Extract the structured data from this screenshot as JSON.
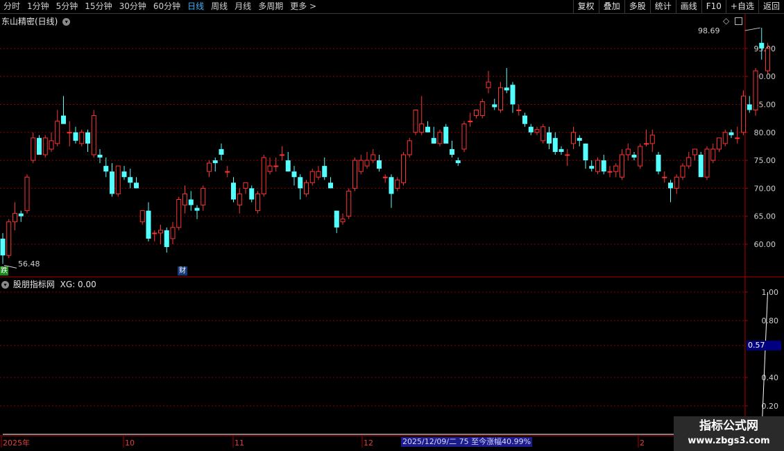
{
  "toolbar": {
    "periods": [
      "分时",
      "1分钟",
      "5分钟",
      "15分钟",
      "30分钟",
      "60分钟",
      "日线",
      "周线",
      "月线",
      "多周期",
      "更多 >"
    ],
    "active_period": "日线",
    "buttons": [
      "复权",
      "叠加",
      "多股",
      "统计",
      "画线",
      "F10",
      "+自选",
      "返回"
    ]
  },
  "main_panel": {
    "title": "东山精密(日线)",
    "high_label": "98.69",
    "low_label": "56.48",
    "left_marker": "跌",
    "finance_marker": "财",
    "corner_icons": [
      "diamond-icon",
      "window-icon"
    ]
  },
  "indicator_panel": {
    "title": "股朋指标网",
    "formula": "XG: 0.00",
    "current_value_label": "0.57"
  },
  "date_axis": {
    "labels": [
      "2025年",
      "10",
      "11",
      "12",
      "2"
    ],
    "status": "2025/12/09/二 75 至今涨幅40.99%"
  },
  "watermark": {
    "title": "指标公式网",
    "url": "www.zbgs3.com"
  },
  "colors": {
    "up": "#ff3232",
    "down": "#54ffff",
    "grid": "#8b0000",
    "axis": "#b00000",
    "active": "#3fb3ff",
    "xg_line": "#ffffff"
  },
  "chart_data": [
    {
      "type": "candlestick",
      "title": "东山精密(日线)",
      "ylim": [
        55,
        100
      ],
      "yticks": [
        "60.00",
        "65.00",
        "70.00",
        "75.00",
        "80.00",
        "85.00",
        "90.00",
        "95.00"
      ],
      "ohlc": [
        [
          61,
          62,
          56.48,
          58
        ],
        [
          58,
          64.5,
          57.5,
          64
        ],
        [
          64,
          67.5,
          62.5,
          65.5
        ],
        [
          65.5,
          66,
          64,
          65
        ],
        [
          66,
          72.5,
          65.5,
          72
        ],
        [
          75,
          80,
          74.5,
          79
        ],
        [
          79,
          79.5,
          76,
          76
        ],
        [
          76,
          79.5,
          75.5,
          79
        ],
        [
          77,
          80,
          76.5,
          78.5
        ],
        [
          78,
          84,
          77.5,
          82
        ],
        [
          83,
          86.5,
          81.5,
          81.5
        ],
        [
          80,
          82,
          77.5,
          80
        ],
        [
          80,
          81,
          78,
          78.5
        ],
        [
          78,
          80.5,
          77.5,
          80
        ],
        [
          80,
          80.5,
          76.5,
          78
        ],
        [
          76,
          84,
          75.5,
          83
        ],
        [
          76,
          77,
          74.5,
          75.5
        ],
        [
          74,
          75.5,
          72,
          73
        ],
        [
          73,
          74.5,
          68.5,
          69
        ],
        [
          69,
          74,
          68.5,
          74
        ],
        [
          73,
          74,
          71.5,
          72
        ],
        [
          72,
          73.5,
          70,
          71
        ],
        [
          71,
          72,
          70,
          70
        ],
        [
          64,
          66,
          63.5,
          66
        ],
        [
          66,
          67.5,
          60.5,
          61
        ],
        [
          62,
          62.5,
          60.5,
          62
        ],
        [
          62,
          63.5,
          60,
          62.5
        ],
        [
          62.5,
          63,
          58.5,
          59.5
        ],
        [
          61,
          64,
          60,
          63
        ],
        [
          63,
          68.5,
          62.5,
          68
        ],
        [
          67,
          70.5,
          65.5,
          69
        ],
        [
          68,
          69.5,
          66,
          67
        ],
        [
          66.5,
          67,
          64.5,
          66
        ],
        [
          67,
          70.5,
          66,
          70
        ],
        [
          73,
          75,
          72,
          74.5
        ],
        [
          75,
          75.5,
          73,
          74.5
        ],
        [
          77,
          78,
          75,
          76
        ],
        [
          73,
          74,
          72,
          73
        ],
        [
          71,
          72,
          67.5,
          68
        ],
        [
          67,
          70,
          65.5,
          69
        ],
        [
          70,
          71,
          69,
          71
        ],
        [
          70,
          70.5,
          67.5,
          68
        ],
        [
          66,
          69.5,
          65.5,
          69
        ],
        [
          69,
          76,
          68.5,
          75.5
        ],
        [
          73,
          75.5,
          72.5,
          74
        ],
        [
          74,
          75.5,
          73,
          74
        ],
        [
          76,
          77.5,
          75,
          76
        ],
        [
          75,
          76.5,
          73,
          73
        ],
        [
          73,
          74,
          70.5,
          72
        ],
        [
          72,
          72.5,
          68,
          70
        ],
        [
          69,
          71.5,
          68.5,
          71
        ],
        [
          71,
          73.5,
          70.5,
          73
        ],
        [
          72,
          74,
          71.5,
          73
        ],
        [
          74,
          75.5,
          71.5,
          72
        ],
        [
          71,
          72,
          70.5,
          70
        ],
        [
          66,
          66,
          62,
          63
        ],
        [
          64,
          65.5,
          63.5,
          64.5
        ],
        [
          65,
          70,
          64.5,
          69.5
        ],
        [
          70,
          75.5,
          69.5,
          75
        ],
        [
          73,
          76,
          72.5,
          75
        ],
        [
          74,
          76.5,
          73.5,
          75
        ],
        [
          75,
          77,
          74.5,
          76
        ],
        [
          75,
          76,
          73,
          73.5
        ],
        [
          72,
          72.5,
          71,
          72
        ],
        [
          72,
          72.5,
          66.5,
          69
        ],
        [
          70,
          72,
          69.5,
          71.5
        ],
        [
          71,
          76.5,
          70.5,
          76
        ],
        [
          76,
          79,
          75.5,
          78.5
        ],
        [
          80,
          84,
          79.5,
          84
        ],
        [
          80,
          86.5,
          79.5,
          81.5
        ],
        [
          81,
          82,
          80.5,
          80
        ],
        [
          79,
          81,
          78,
          78
        ],
        [
          78,
          80.5,
          77.5,
          80
        ],
        [
          81,
          81.5,
          78.5,
          78
        ],
        [
          77,
          78.5,
          75.5,
          76
        ],
        [
          75,
          75.5,
          74,
          74.5
        ],
        [
          77,
          82,
          76.5,
          81.5
        ],
        [
          82,
          83.5,
          81,
          82
        ],
        [
          83,
          84,
          82.5,
          84
        ],
        [
          83,
          86,
          82.5,
          85.5
        ],
        [
          88,
          91,
          87,
          89
        ],
        [
          85,
          86,
          84,
          84.5
        ],
        [
          84,
          89,
          83.5,
          88
        ],
        [
          88,
          91.5,
          87,
          87.5
        ],
        [
          88.5,
          89,
          83.5,
          85
        ],
        [
          84,
          85,
          83,
          84
        ],
        [
          83,
          83.5,
          81,
          81.5
        ],
        [
          81,
          81.5,
          79.5,
          80
        ],
        [
          80,
          81,
          79.5,
          80.5
        ],
        [
          78.5,
          81.5,
          78,
          81
        ],
        [
          80,
          81,
          77,
          78
        ],
        [
          79,
          80,
          76,
          76.5
        ],
        [
          77,
          77.5,
          76,
          76.5
        ],
        [
          76,
          77,
          74,
          76
        ],
        [
          78,
          81,
          77,
          80
        ],
        [
          79,
          79.5,
          77.5,
          78.5
        ],
        [
          78,
          78,
          73.5,
          75
        ],
        [
          74,
          75,
          73,
          73.5
        ],
        [
          73,
          75.5,
          72.5,
          75
        ],
        [
          75,
          76,
          72.5,
          73
        ],
        [
          73,
          74,
          72,
          73
        ],
        [
          73,
          74.5,
          72,
          74
        ],
        [
          72,
          77,
          71.5,
          76
        ],
        [
          76,
          78,
          75,
          77
        ],
        [
          76,
          76.5,
          75,
          75.5
        ],
        [
          74,
          78,
          73.5,
          77.5
        ],
        [
          78,
          80.5,
          77.5,
          78
        ],
        [
          78,
          80.5,
          76.5,
          79.5
        ],
        [
          76,
          76.5,
          72.5,
          73
        ],
        [
          72,
          73,
          71,
          72
        ],
        [
          71,
          71.5,
          67.5,
          70
        ],
        [
          70,
          72.5,
          69,
          72
        ],
        [
          72,
          74.5,
          71.5,
          74
        ],
        [
          74,
          76.5,
          73.5,
          75.5
        ],
        [
          76,
          77,
          75,
          77
        ],
        [
          76,
          76.5,
          72,
          72
        ],
        [
          72,
          77.5,
          71.5,
          77
        ],
        [
          75,
          78,
          74.5,
          77
        ],
        [
          77,
          79,
          76.5,
          79
        ],
        [
          78,
          80.5,
          77.5,
          80
        ],
        [
          80,
          80.5,
          79,
          79.5
        ],
        [
          79,
          81,
          78,
          79
        ],
        [
          80,
          87.5,
          79.5,
          86.5
        ],
        [
          85,
          86.5,
          83.5,
          84
        ],
        [
          84,
          91.5,
          83,
          91
        ],
        [
          96,
          98.69,
          93,
          95
        ],
        [
          91,
          96,
          90.5,
          95
        ]
      ],
      "high": 98.69,
      "low": 56.48
    },
    {
      "type": "line",
      "title": "股朋指标网",
      "series": [
        {
          "name": "XG",
          "values_note_free": true
        }
      ],
      "ylim": [
        0,
        1.1
      ],
      "yticks": [
        "0.20",
        "0.40",
        "0.80",
        "1.00"
      ],
      "spike_index": 126,
      "spike_value": 1.0,
      "base_value": 0.0
    }
  ]
}
